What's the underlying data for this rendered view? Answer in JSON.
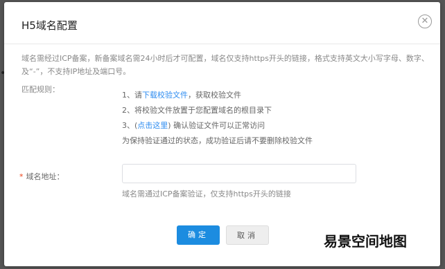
{
  "dialog": {
    "title": "H5域名配置",
    "close_icon": "close-circle-icon",
    "notice_line1": "域名需经过ICP备案，新备案域名需24小时后才可配置，域名仅支持https开头的链接，格式支持英文大小写字母、数字、",
    "notice_line2": "及“-”，不支持IP地址及端口号。",
    "rules_label": "匹配规则：",
    "rule1_prefix": "1、请",
    "rule1_link": "下载校验文件",
    "rule1_suffix": "，获取校验文件",
    "rule2": "2、将校验文件放置于您配置域名的根目录下",
    "rule3_prefix": "3、(",
    "rule3_link": "点击这里",
    "rule3_suffix": ") 确认验证文件可以正常访问",
    "rule4": "为保持验证通过的状态，成功验证后请不要删除校验文件",
    "domain_required_mark": "*",
    "domain_label": "域名地址：",
    "domain_value": "",
    "domain_placeholder": "",
    "domain_hint": "域名需通过ICP备案验证，仅支持https开头的链接",
    "confirm_label": "确定",
    "cancel_label": "取消"
  },
  "watermark": "易景空间地图",
  "colors": {
    "primary": "#1c8ce0",
    "link": "#2d8cf0",
    "required": "#ed3f14"
  }
}
